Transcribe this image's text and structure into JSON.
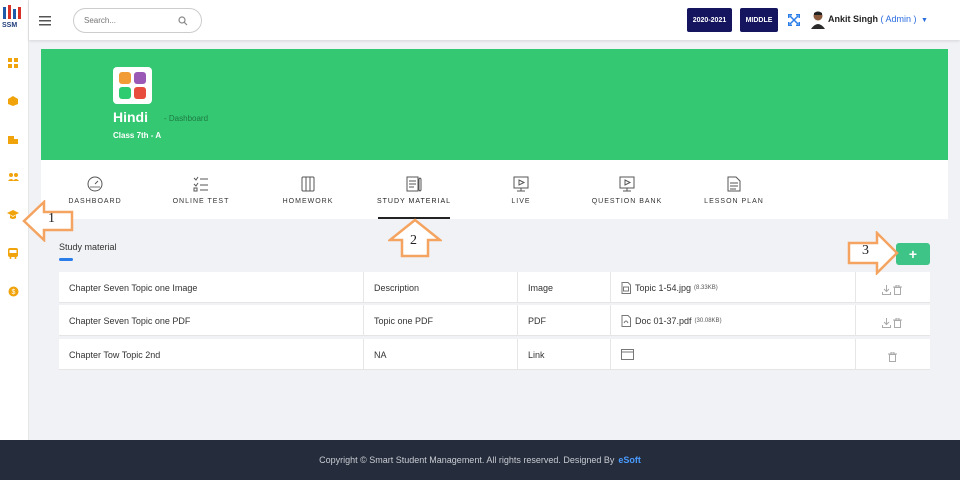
{
  "app": {
    "logo_text": "SSM"
  },
  "header": {
    "search_placeholder": "Search...",
    "session": "2020-2021",
    "level": "MIDDLE",
    "user_name": "Ankit Singh",
    "user_role": "( Admin )"
  },
  "subject": {
    "title": "Hindi",
    "crumb": "Dashboard",
    "class_label": "Class 7th - A"
  },
  "tabs": [
    {
      "label": "DASHBOARD",
      "icon": "gauge-icon"
    },
    {
      "label": "ONLINE TEST",
      "icon": "checklist-icon"
    },
    {
      "label": "HOMEWORK",
      "icon": "book-icon"
    },
    {
      "label": "STUDY MATERIAL",
      "icon": "notebook-icon",
      "active": true
    },
    {
      "label": "LIVE",
      "icon": "play-screen-icon"
    },
    {
      "label": "QUESTION BANK",
      "icon": "play-screen-icon"
    },
    {
      "label": "LESSON PLAN",
      "icon": "document-icon"
    }
  ],
  "section": {
    "title": "Study material",
    "add_label": "+"
  },
  "materials": [
    {
      "title": "Chapter Seven Topic one Image",
      "description": "Description",
      "type": "Image",
      "file": "Topic 1-54.jpg",
      "size": "(8.33KB)",
      "file_icon": "image-file-icon",
      "actions": [
        "download-icon",
        "trash-icon"
      ]
    },
    {
      "title": "Chapter Seven Topic one PDF",
      "description": "Topic one PDF",
      "type": "PDF",
      "file": "Doc 01-37.pdf",
      "size": "(30.08KB)",
      "file_icon": "pdf-file-icon",
      "actions": [
        "download-icon",
        "trash-icon"
      ]
    },
    {
      "title": "Chapter Tow Topic 2nd",
      "description": "NA",
      "type": "Link",
      "file": "",
      "size": "",
      "file_icon": "browser-icon",
      "actions": [
        "trash-icon"
      ]
    }
  ],
  "footer": {
    "text": "Copyright ©  Smart Student Management. All rights reserved. Designed By",
    "brand": "eSoft"
  },
  "callouts": [
    "1",
    "2",
    "3"
  ],
  "colors": {
    "banner": "#34c872",
    "pill": "#15145e",
    "add_button": "#3ec486",
    "footer": "#252c3b",
    "callout_arrow": "#f4a460",
    "sidebar_icon": "#f0a30a"
  }
}
